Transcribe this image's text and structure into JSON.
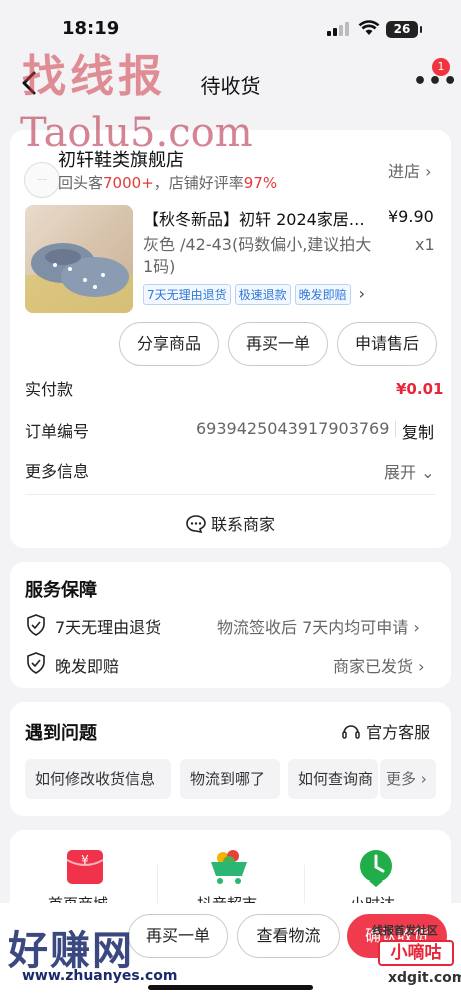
{
  "status": {
    "time": "18:19",
    "battery": "26"
  },
  "nav": {
    "title": "待收货",
    "badge": "1"
  },
  "watermarks": {
    "top": "找线报",
    "mid": "Taolu5.com",
    "bottom_left": "好赚网",
    "bottom_url": "www.zhuanyes.com",
    "bottom_right_top": "线报首发社区",
    "bottom_right": "小嘀咕",
    "bottom_right_url": "xdgit.com"
  },
  "shop": {
    "name": "初轩鞋类旗舰店",
    "sub_prefix": "回头客",
    "repeat_count": "7000+",
    "sub_mid": "，店铺好评率",
    "rating": "97%",
    "enter_label": "进店"
  },
  "product": {
    "name": "【秋冬新品】初轩 2024家居…",
    "price": "¥9.90",
    "spec": "灰色 /42-43(码数偏小,建议拍大 1码)",
    "qty": "x1",
    "tags": [
      "7天无理由退货",
      "极速退款",
      "晚发即赔"
    ]
  },
  "actions": {
    "share": "分享商品",
    "rebuy": "再买一单",
    "aftersale": "申请售后"
  },
  "order": {
    "paid_label": "实付款",
    "paid_value": "¥0.01",
    "number_label": "订单编号",
    "number_value": "6939425043917903769",
    "copy_label": "复制",
    "more_label": "更多信息",
    "expand_label": "展开"
  },
  "contact_label": "联系商家",
  "service": {
    "title": "服务保障",
    "items": [
      {
        "label": "7天无理由退货",
        "value": "物流签收后 7天内均可申请"
      },
      {
        "label": "晚发即赔",
        "value": "商家已发货"
      }
    ]
  },
  "issues": {
    "title": "遇到问题",
    "official": "官方客服",
    "chips": [
      "如何修改收货信息",
      "物流到哪了",
      "如何查询商"
    ],
    "more": "更多"
  },
  "shortcuts": [
    "首页商城",
    "抖音超市",
    "小时达"
  ],
  "bottom": {
    "rebuy": "再买一单",
    "logistics": "查看物流",
    "confirm": "确认收货"
  },
  "colors": {
    "red": "#e33a3a",
    "price_red": "#e8263a",
    "tag_blue": "#2f78d9",
    "badge": "#f0333e"
  }
}
